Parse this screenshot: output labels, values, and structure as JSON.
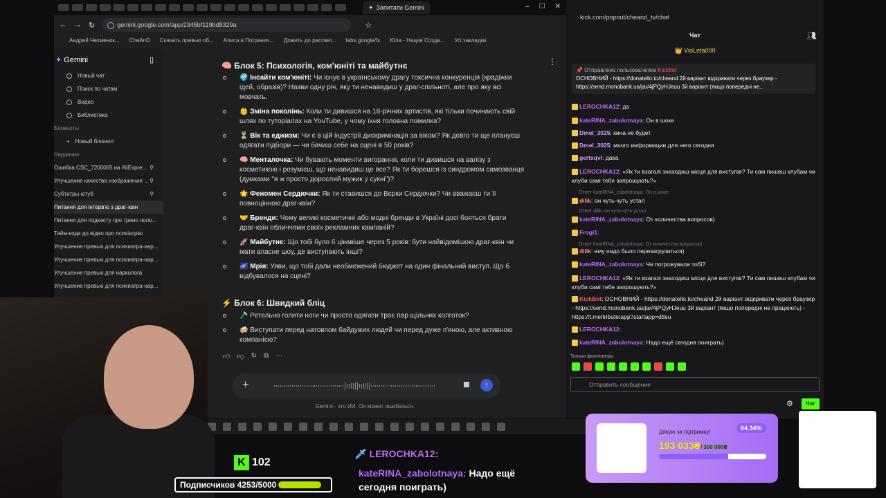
{
  "browser": {
    "tab_active": "Запитати Gemini",
    "url": "gemini.google.com/app/2345bf119bd8329a",
    "bookmarks": [
      "Андрей Чехменок...",
      "CheAnD",
      "Скачать превью об...",
      "Алиса в Погранич...",
      "Дожить до рассвет...",
      "labs.google/fx",
      "Юла - Нация Созда...",
      "Усі закладки"
    ]
  },
  "sidebar": {
    "brand": "Gemini",
    "items": [
      "Новый чат",
      "Поиск по чатам",
      "Видео",
      "Библиотека"
    ],
    "notebooks_title": "Блокноты",
    "new_notebook": "Новый блокнот",
    "recent_title": "Недавние",
    "recent": [
      "Ошибка CSC_7200065 на AliExpre...",
      "Улучшение качества изображения ...",
      "Субтитры ютуб",
      "Питання для інтерв'ю з драг-квін",
      "Питання для подкасту про транс-чоло...",
      "Тайм-коди до відео про психіатрію",
      "Улучшение превью для психиатра-нар...",
      "Улучшение превью для психиатра-нар...",
      "Улучшение превью для нарколога",
      "Улучшение превью для психиатра-нар..."
    ]
  },
  "main": {
    "block5_title": "Блок 5: Психологія, ком'юніті та майбутнє",
    "block5_items": [
      {
        "bold": "Інсайти ком'юніті:",
        "text": " Чи існує в українському драгу токсична конкуренція (крадіжки ідей, образів)? Назви одну річ, яку ти ненавидиш у драг-спільноті, але про яку всі мовчать."
      },
      {
        "bold": "Зміна поколінь:",
        "text": " Коли ти дивишся на 18-річних артистів, які тільки починають свій шлях по туторіалах на YouTube, у чому їхня головна помилка?"
      },
      {
        "bold": "Вік та еджизм:",
        "text": " Чи є в цій індустрії дискримінація за віком? Як довго ти ще плануєш одягати підбори — чи бачиш себе на сцені в 50 років?"
      },
      {
        "bold": "Менталочка:",
        "text": " Чи бувають моменти вигорання, коли ти дивишся на валізу з косметикою і розумієш, що ненавидиш це все? Як ти борешся із синдромом самозванця (думками \"я ж просто дорослий мужик у сукні\")?"
      },
      {
        "bold": "Феномен Сердючки:",
        "text": " Як ти ставишся до Вєрки Сердючки? Чи вважаєш ти її повноцінною драг-квін?"
      },
      {
        "bold": "Бренди:",
        "text": " Чому великі косметичні або модні бренди в Україні досі бояться брати драг-квін обличчями своїх рекламних кампаній?"
      },
      {
        "bold": "Майбутнє:",
        "text": " Що тобі було б цікавіше через 5 років: бути найвідомішою драг-квін чи мати власне шоу, де виступають інші?"
      },
      {
        "bold": "Мрія:",
        "text": " Уяви, що тобі дали необмежений бюджет на один фінальний виступ. Що б відбувалося на сцені?"
      }
    ],
    "block6_title": "Блок 6: Швидкий бліц",
    "block6_items": [
      "Ретельно голити ноги чи просто одягати троє пар щільних колготок?",
      "Виступати перед натовпом байдужих людей чи перед дуже п'яною, але активною компанією?"
    ],
    "disclaimer": "Gemini - это ИИ. Он может ошибаться."
  },
  "chat": {
    "url": "kick.com/popout/cheand_tv/chat",
    "title": "Чат",
    "top_user": "VioLeta000",
    "pinned_by": "Отправлено пользователем",
    "pinned_user": "KickBot",
    "pinned_text": "ОСНОВНИЙ - https://donatello.to/cheand 2й варіант відкривати через браузер - https://send.monobank.ua/jar/4jPQyHJeuu 3й варіант (якщо попередні не...",
    "messages": [
      {
        "user": "LEROCHKA12",
        "color": "#c86cf5",
        "text": "да"
      },
      {
        "user": "kateRINA_zabolotnaya",
        "color": "#b86cff",
        "text": "Он в шоке"
      },
      {
        "user": "Dmel_3025",
        "color": "#d3a0ff",
        "text": "кина не будет"
      },
      {
        "user": "Dmel_3025",
        "color": "#d3a0ff",
        "text": "много информации для него сегодня"
      },
      {
        "user": "gertsqvi",
        "color": "#d3a0ff",
        "text": "дава"
      },
      {
        "user": "LEROCHKA12",
        "color": "#c86cf5",
        "text": "«Як ти взагалі знаходиш місця для виступів? Ти сам пишеш клубам чи клуби самі тебе запрошують?»"
      },
      {
        "user": "dilik",
        "color": "#ff8a8a",
        "text": "он чуть-чуть устал"
      },
      {
        "user": "kateRINA_zabolotnaya",
        "color": "#b86cff",
        "text": "От количества вопросов)"
      },
      {
        "user": "Frogi1",
        "color": "#c86cf5",
        "text": ""
      },
      {
        "user": "dilik",
        "color": "#ff8a8a",
        "text": "ему надо было перезагрузиться)"
      },
      {
        "user": "kateRINA_zabolotnaya",
        "color": "#b86cff",
        "text": "Чи погрожували тобі?"
      },
      {
        "user": "LEROCHKA12",
        "color": "#c86cf5",
        "text": "«Як ти взагалі знаходиш місця для виступів? Ти сам пишеш клубам чи клуби самі тебе запрошують?»"
      },
      {
        "user": "KickBot",
        "color": "#ff5a5a",
        "text": "ОСНОВНИЙ - https://donatello.to/cheand 2й варіант відкривати через браузер - https://send.monobank.ua/jar/4jPQyHJeuu 3й варіант (якщо попередні не працюють) - https://t.me/tribute/app?startapp=d8su"
      },
      {
        "user": "LEROCHKA12",
        "color": "#c86cf5",
        "text": ""
      },
      {
        "user": "kateRINA_zabolotnaya",
        "color": "#b86cff",
        "text": "Надо ещё сегодня поиграть)"
      }
    ],
    "replies": [
      "Ответ kateRINA_zabolotnaya: Он в шоке",
      "Ответ dilik: он чуть-чуть устал",
      "Ответ kateRINA_zabolotnaya: От количества вопросов)"
    ],
    "followers_only": "Только фолловеры",
    "input_placeholder": "Отправить сообщение",
    "send_label": "Чат"
  },
  "overlay": {
    "kick_count": "102",
    "subs": "Подписчиков 4253/5000",
    "ovl_user1": "LEROCHKA12:",
    "ovl_user2": "kateRINA_zabolotnaya:",
    "ovl_text2": "Надо ещё",
    "ovl_text3": "сегодня поиграть)",
    "donate_title": "Дякую за підтримку!",
    "donate_percent": "64.34%",
    "donate_amount": "193 033₴",
    "donate_goal": "/ 300 000₴",
    "donate_progress": 0.6434
  }
}
